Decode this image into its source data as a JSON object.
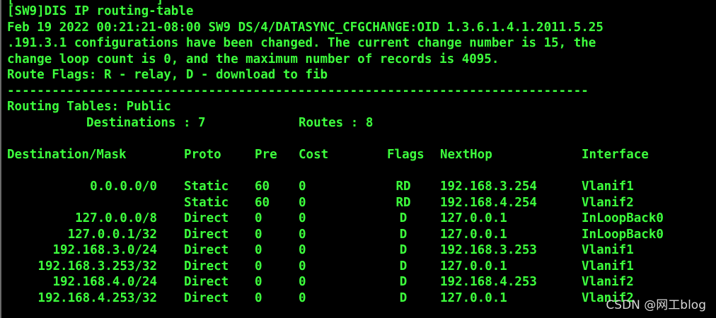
{
  "terminal": {
    "partial_top": "[                   ]",
    "command": "[SW9]DIS IP routing-table",
    "log_line_1": "Feb 19 2022 00:21:21-08:00 SW9 DS/4/DATASYNC_CFGCHANGE:OID 1.3.6.1.4.1.2011.5.25",
    "log_line_2": ".191.3.1 configurations have been changed. The current change number is 15, the",
    "log_line_3": "change loop count is 0, and the maximum number of records is 4095.",
    "flags_line": "Route Flags: R - relay, D - download to fib",
    "separator": "------------------------------------------------------------------------------",
    "tables_line": "Routing Tables: Public",
    "dest_label": "Destinations : 7",
    "routes_label": "Routes : 8",
    "headers": [
      "Destination/Mask",
      "Proto",
      "Pre",
      "Cost",
      "Flags",
      "NextHop",
      "Interface"
    ],
    "rows": [
      [
        "0.0.0.0/0",
        "Static",
        "60",
        "0",
        "RD",
        "192.168.3.254",
        "Vlanif1"
      ],
      [
        "",
        "Static",
        "60",
        "0",
        "RD",
        "192.168.4.254",
        "Vlanif2"
      ],
      [
        "127.0.0.0/8",
        "Direct",
        "0",
        "0",
        "D",
        "127.0.0.1",
        "InLoopBack0"
      ],
      [
        "127.0.0.1/32",
        "Direct",
        "0",
        "0",
        "D",
        "127.0.0.1",
        "InLoopBack0"
      ],
      [
        "192.168.3.0/24",
        "Direct",
        "0",
        "0",
        "D",
        "192.168.3.253",
        "Vlanif1"
      ],
      [
        "192.168.3.253/32",
        "Direct",
        "0",
        "0",
        "D",
        "127.0.0.1",
        "Vlanif1"
      ],
      [
        "192.168.4.0/24",
        "Direct",
        "0",
        "0",
        "D",
        "192.168.4.253",
        "Vlanif2"
      ],
      [
        "192.168.4.253/32",
        "Direct",
        "0",
        "0",
        "D",
        "127.0.0.1",
        "Vlanif2"
      ]
    ],
    "text_color": "#3dff3d",
    "background_color": "#000000"
  },
  "watermark": "CSDN @网工blog"
}
